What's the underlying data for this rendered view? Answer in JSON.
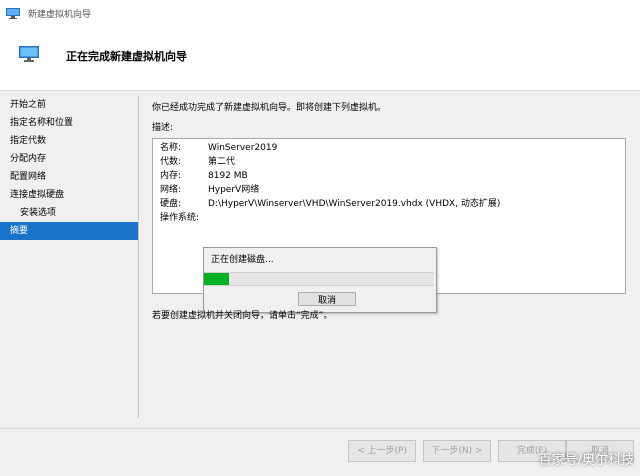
{
  "window": {
    "title": "新建虚拟机向导"
  },
  "header": {
    "title": "正在完成新建虚拟机向导"
  },
  "sidebar": {
    "items": [
      {
        "label": "开始之前"
      },
      {
        "label": "指定名称和位置"
      },
      {
        "label": "指定代数"
      },
      {
        "label": "分配内存"
      },
      {
        "label": "配置网络"
      },
      {
        "label": "连接虚拟硬盘"
      },
      {
        "label": "安装选项"
      },
      {
        "label": "摘要"
      }
    ],
    "active_index": 7
  },
  "main": {
    "intro": "你已经成功完成了新建虚拟机向导。即将创建下列虚拟机。",
    "description_label": "描述:",
    "rows": [
      {
        "key": "名称:",
        "value": "WinServer2019"
      },
      {
        "key": "代数:",
        "value": "第二代"
      },
      {
        "key": "内存:",
        "value": "8192 MB"
      },
      {
        "key": "网络:",
        "value": "HyperV网络"
      },
      {
        "key": "硬盘:",
        "value": "D:\\HyperV\\Winserver\\VHD\\WinServer2019.vhdx (VHDX, 动态扩展)"
      },
      {
        "key": "操作系统:",
        "value": ""
      }
    ],
    "footer_note": "若要创建虚拟机并关闭向导，请单击“完成”。"
  },
  "progress_dialog": {
    "text": "正在创建磁盘...",
    "progress": 0.11,
    "cancel_label": "取消"
  },
  "buttons": {
    "prev": "< 上一步(P)",
    "next": "下一步(N) >",
    "finish": "完成(F)",
    "cancel": "取消"
  },
  "watermark": "百家号/奥尔科技",
  "colors": {
    "accent": "#1a73c8",
    "progress": "#06b025"
  }
}
